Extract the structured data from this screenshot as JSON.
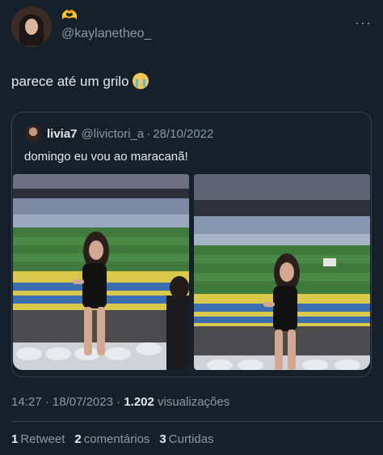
{
  "author": {
    "header_emoji": "🫶",
    "handle": "@kaylanetheo_",
    "more_label": "···"
  },
  "tweet": {
    "text": "parece até um grilo"
  },
  "quoted": {
    "name": "livia7",
    "handle": "@livictori_a",
    "separator": "·",
    "date": "28/10/2022",
    "text": "domingo eu vou ao maracanã!"
  },
  "footer": {
    "time": "14:27",
    "sep1": "·",
    "date": "18/07/2023",
    "sep2": "·",
    "views_count": "1.202",
    "views_label": "visualizações"
  },
  "stats": {
    "retweets_count": "1",
    "retweets_label": "Retweet",
    "comments_count": "2",
    "comments_label": "comentários",
    "likes_count": "3",
    "likes_label": "Curtidas"
  },
  "colors": {
    "background": "#15202b",
    "text": "#e7e9ea",
    "secondary": "#8b98a5",
    "border": "#38444d"
  }
}
